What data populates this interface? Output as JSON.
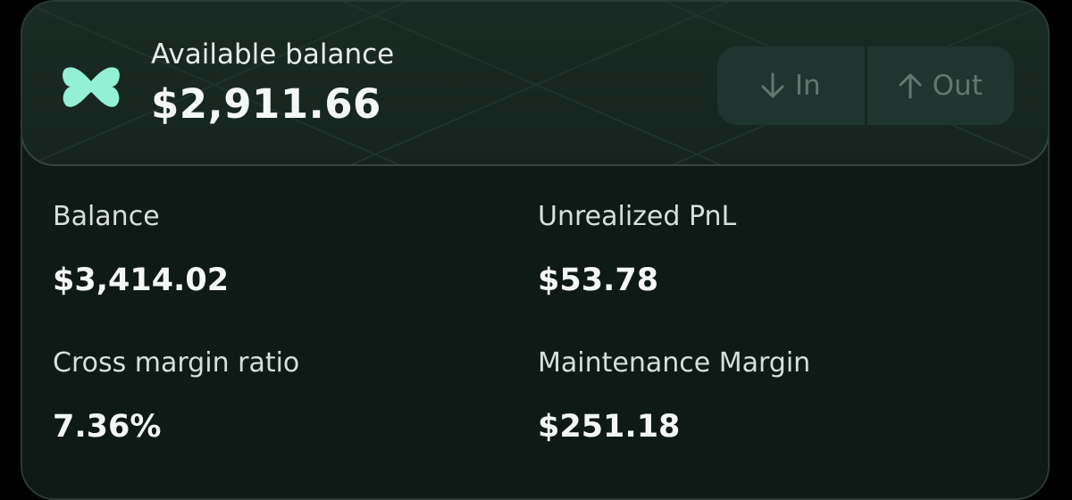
{
  "header": {
    "available_label": "Available balance",
    "available_value": "$2,911.66",
    "logo_icon": "brand-logo-icon",
    "brand_color": "#93f0d4"
  },
  "actions": {
    "in_label": "In",
    "in_icon": "arrow-down-icon",
    "out_label": "Out",
    "out_icon": "arrow-up-icon"
  },
  "stats": {
    "balance": {
      "label": "Balance",
      "value": "$3,414.02"
    },
    "unrealized_pnl": {
      "label": "Unrealized PnL",
      "value": "$53.78"
    },
    "cross_margin_ratio": {
      "label": "Cross margin ratio",
      "value": "7.36%"
    },
    "maintenance_margin": {
      "label": "Maintenance Margin",
      "value": "$251.18"
    }
  }
}
